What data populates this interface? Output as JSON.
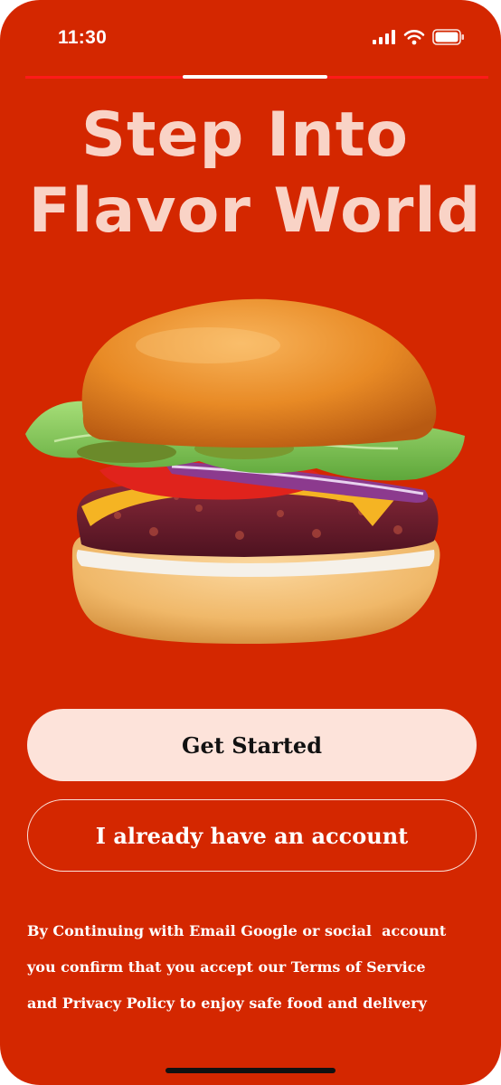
{
  "status_bar": {
    "time": "11:30",
    "icons": [
      "cellular-signal-icon",
      "wifi-icon",
      "battery-icon"
    ]
  },
  "headline": {
    "line1": "Step Into",
    "line2": "Flavor World"
  },
  "hero_image": {
    "subject": "burger"
  },
  "buttons": {
    "get_started": "Get Started",
    "have_account": "I already have an account"
  },
  "terms": {
    "line1": "By Continuing with Email Google or social  account",
    "line2": "you confirm that you accept our Terms of Service",
    "line3": "and Privacy Policy to enjoy safe food and delivery"
  },
  "colors": {
    "background": "#d42700",
    "headline": "#f9d3c6",
    "primary_button": "#fde3da",
    "accent_line": "#ff1a1a"
  }
}
